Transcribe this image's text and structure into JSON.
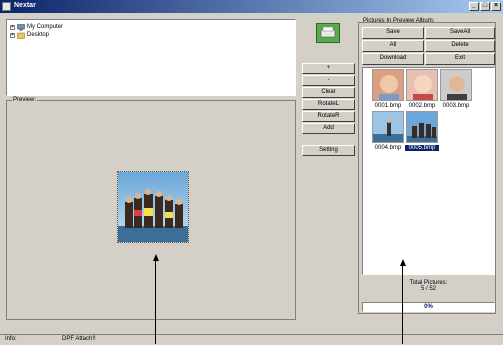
{
  "window": {
    "title": "Nextar"
  },
  "tree": {
    "items": [
      {
        "label": "My Computer"
      },
      {
        "label": "Desktop"
      }
    ]
  },
  "preview": {
    "label": "Preview:"
  },
  "middle_buttons": [
    "+",
    "-",
    "Clear",
    "RotateL",
    "RotateR",
    "Add",
    "Setting"
  ],
  "album": {
    "label": "Pictures In Preview Album:",
    "buttons": [
      "Save",
      "SaveAll",
      "All",
      "Delete",
      "Download",
      "Exit"
    ],
    "thumbnails": [
      "0001.bmp",
      "0002.bmp",
      "0003.bmp",
      "0004.bmp",
      "0005.bmp"
    ],
    "selected": "0005.bmp",
    "total_label": "Total Pictures:",
    "total_value": "5 / 52",
    "progress_text": "0%"
  },
  "status": {
    "info_label": "Info:",
    "info_value": "DPF Attach!!"
  },
  "colors": {
    "title_start": "#0a246a",
    "title_end": "#a6caf0",
    "face": "#d4d0c8",
    "selection": "#0a246a"
  }
}
